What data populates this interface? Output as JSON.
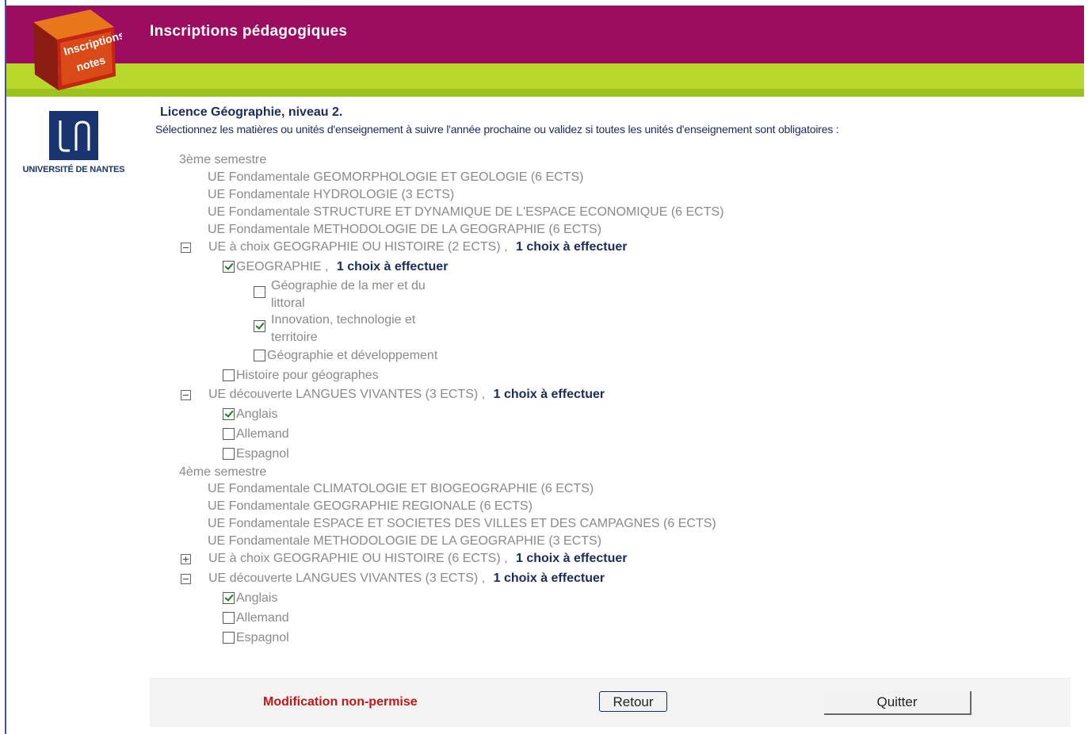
{
  "header": {
    "title": "Inscriptions pédagogiques",
    "logo_line1": "Inscriptions",
    "logo_line2": "notes"
  },
  "university": {
    "name": "UNIVERSITÉ DE NANTES"
  },
  "content": {
    "title": "Licence Géographie, niveau 2.",
    "instructions": "Sélectionnez les matières ou unités d'enseignement à suivre l'année prochaine ou validez si toutes les unités d'enseignement sont obligatoires :"
  },
  "sem3": {
    "label": "3ème semestre",
    "ue1": "UE Fondamentale GEOMORPHOLOGIE ET GEOLOGIE (6 ECTS)",
    "ue2": "UE Fondamentale HYDROLOGIE (3 ECTS)",
    "ue3": "UE Fondamentale STRUCTURE ET DYNAMIQUE DE L'ESPACE ECONOMIQUE (6 ECTS)",
    "ue4": "UE Fondamentale METHODOLOGIE DE LA GEOGRAPHIE (6 ECTS)",
    "choix": {
      "label": "UE à choix GEOGRAPHIE OU HISTOIRE (2 ECTS) ,",
      "req": "1 choix à effectuer"
    },
    "geo": {
      "label": "GEOGRAPHIE ,",
      "req": "1 choix à effectuer"
    },
    "geo_sub1": "Géographie de la mer et du littoral",
    "geo_sub2": "Innovation, technologie et territoire",
    "geo_sub3": "Géographie et développement",
    "histoire": "Histoire pour géographes",
    "langues": {
      "label": "UE découverte LANGUES VIVANTES (3 ECTS) ,",
      "req": "1 choix à effectuer"
    },
    "lang1": "Anglais",
    "lang2": "Allemand",
    "lang3": "Espagnol"
  },
  "sem4": {
    "label": "4ème semestre",
    "ue1": "UE Fondamentale CLIMATOLOGIE ET BIOGEOGRAPHIE (6 ECTS)",
    "ue2": "UE Fondamentale GEOGRAPHIE REGIONALE (6 ECTS)",
    "ue3": "UE Fondamentale ESPACE ET SOCIETES DES VILLES ET DES CAMPAGNES (6 ECTS)",
    "ue4": "UE Fondamentale METHODOLOGIE DE LA GEOGRAPHIE (3 ECTS)",
    "choix": {
      "label": "UE à choix GEOGRAPHIE OU HISTOIRE (6 ECTS) ,",
      "req": "1 choix à effectuer"
    },
    "langues": {
      "label": "UE découverte LANGUES VIVANTES (3 ECTS) ,",
      "req": "1 choix à effectuer"
    },
    "lang1": "Anglais",
    "lang2": "Allemand",
    "lang3": "Espagnol"
  },
  "footer": {
    "warning": "Modification non-permise",
    "retour": "Retour",
    "quitter": "Quitter"
  },
  "colors": {
    "header_bg": "#9c0d5f",
    "green": "#b8d82c",
    "navy": "#1b2c5c",
    "warning": "#c41616"
  }
}
